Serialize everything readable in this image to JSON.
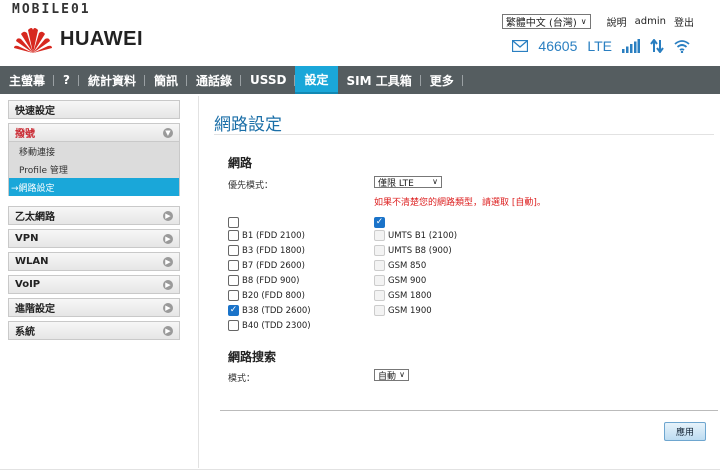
{
  "watermark": "MOBILE01",
  "brand": {
    "logo_text": "HUAWEI"
  },
  "top_links": {
    "language": "繁體中文 (台灣)",
    "help": "說明",
    "user": "admin",
    "logout": "登出"
  },
  "status": {
    "operator": "46605",
    "network": "LTE"
  },
  "nav": [
    {
      "label": "主螢幕",
      "active": false
    },
    {
      "label": "?",
      "active": false
    },
    {
      "label": "統計資料",
      "active": false
    },
    {
      "label": "簡訊",
      "active": false
    },
    {
      "label": "通話錄",
      "active": false
    },
    {
      "label": "USSD",
      "active": false
    },
    {
      "label": "設定",
      "active": true
    },
    {
      "label": "SIM 工具箱",
      "active": false
    },
    {
      "label": "更多",
      "active": false
    }
  ],
  "sidebar": {
    "quick": "快速設定",
    "dialup": {
      "label": "撥號",
      "subs": [
        "移動連接",
        "Profile 管理",
        "→網路設定"
      ]
    },
    "items": [
      "乙太網路",
      "VPN",
      "WLAN",
      "VoIP",
      "進階設定",
      "系統"
    ]
  },
  "main": {
    "title": "網路設定",
    "network": {
      "heading": "網路",
      "pref_label": "優先模式：",
      "pref_value": "僅限 LTE",
      "warning": "如果不清楚您的網路類型，請選取 [自動]。",
      "lte_bands": [
        {
          "label": "",
          "checked": false
        },
        {
          "label": "B1 (FDD 2100)",
          "checked": false
        },
        {
          "label": "B3 (FDD 1800)",
          "checked": false
        },
        {
          "label": "B7 (FDD 2600)",
          "checked": false
        },
        {
          "label": "B8 (FDD 900)",
          "checked": false
        },
        {
          "label": "B20 (FDD 800)",
          "checked": false
        },
        {
          "label": "B38 (TDD 2600)",
          "checked": true
        },
        {
          "label": "B40 (TDD 2300)",
          "checked": false
        }
      ],
      "other_bands": [
        {
          "label": "",
          "checked": true,
          "disabled": false
        },
        {
          "label": "UMTS B1 (2100)",
          "checked": false,
          "disabled": true
        },
        {
          "label": "UMTS B8 (900)",
          "checked": false,
          "disabled": true
        },
        {
          "label": "GSM 850",
          "checked": false,
          "disabled": true
        },
        {
          "label": "GSM 900",
          "checked": false,
          "disabled": true
        },
        {
          "label": "GSM 1800",
          "checked": false,
          "disabled": true
        },
        {
          "label": "GSM 1900",
          "checked": false,
          "disabled": true
        }
      ]
    },
    "search": {
      "heading": "網路搜索",
      "mode_label": "模式：",
      "mode_value": "自動"
    },
    "apply_label": "應用"
  }
}
